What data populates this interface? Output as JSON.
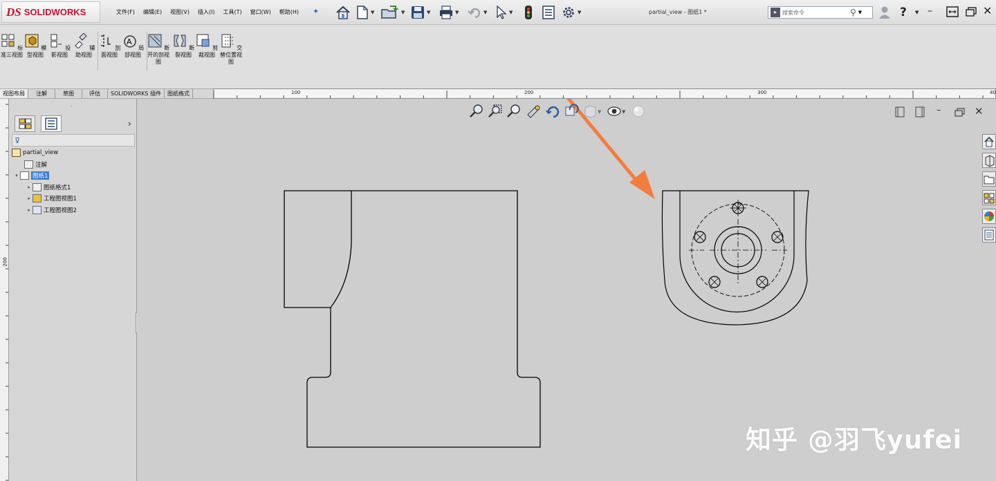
{
  "app": {
    "brand_ds": "DS",
    "brand_name": "SOLIDWORKS",
    "doc_title": "partial_view - 图纸1 *"
  },
  "menu": [
    "文件(F)",
    "编辑(E)",
    "视图(V)",
    "插入(I)",
    "工具(T)",
    "窗口(W)",
    "帮助(H)"
  ],
  "search": {
    "placeholder": "搜索命令"
  },
  "commands": [
    {
      "label": "标准三视图"
    },
    {
      "label": "模型视图"
    },
    {
      "label": "投影视图"
    },
    {
      "label": "辅助视图"
    },
    {
      "label": "剖面视图"
    },
    {
      "label": "局部视图"
    },
    {
      "label": "断开的剖视图"
    },
    {
      "label": "断裂视图"
    },
    {
      "label": "剪裁视图"
    },
    {
      "label": "交替位置视图"
    }
  ],
  "tabs": [
    "视图布局",
    "注解",
    "草图",
    "评估",
    "SOLIDWORKS 插件",
    "图纸格式"
  ],
  "ruler": {
    "h_marks": [
      "100",
      "200",
      "300",
      "40"
    ],
    "v_mark": "200"
  },
  "tree": {
    "root": "partial_view",
    "annotations": "注解",
    "sheet": "图纸1",
    "children": [
      "图纸格式1",
      "工程图视图1",
      "工程图视图2"
    ]
  },
  "icons": {
    "top_left": [
      "pin-icon"
    ],
    "toolbar": [
      "home-icon",
      "new-document-icon",
      "open-icon",
      "save-icon",
      "print-icon",
      "undo-icon",
      "select-icon",
      "rebuild-icon",
      "file-properties-icon",
      "options-icon"
    ],
    "window": [
      "user-icon",
      "help-icon",
      "minimize-icon",
      "restore-icon",
      "maximize-icon",
      "close-icon"
    ],
    "hud": [
      "zoom-to-fit-icon",
      "zoom-to-area-icon",
      "zoom-in-out-icon",
      "pan-icon",
      "rotate-icon",
      "previous-view-icon",
      "section-view-icon",
      "display-style-icon",
      "hide-show-icon",
      "appearance-icon"
    ]
  },
  "colors": {
    "brand_red": "#c8102e",
    "arrow": "#f47c3c",
    "selection": "#3a7bd5",
    "canvas": "#cecece"
  },
  "watermark": "知乎 @羽飞yufei"
}
